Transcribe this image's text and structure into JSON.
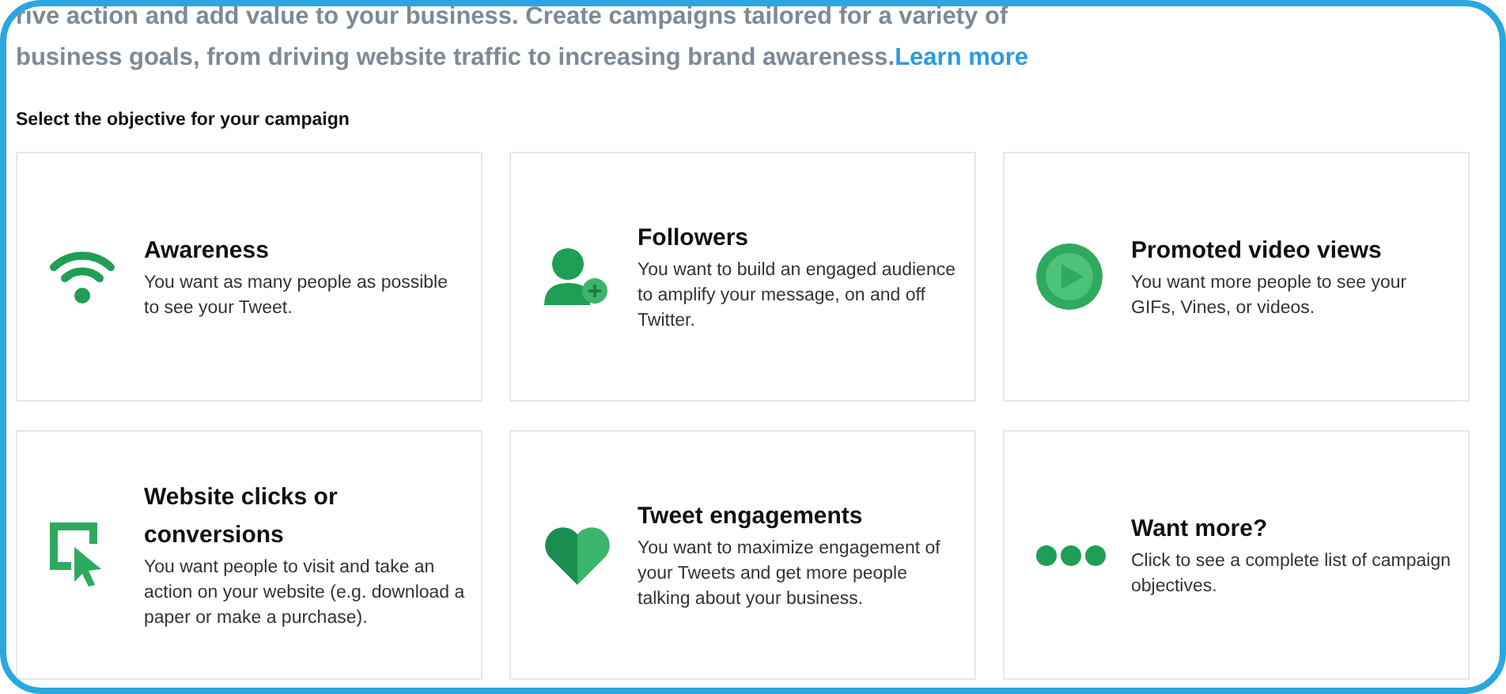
{
  "intro": {
    "lines": [
      "rive action and add value to your business. Create campaigns tailored for a variety of",
      "business goals, from driving website traffic to increasing brand awareness."
    ],
    "link": "Learn more"
  },
  "prompt": "Select the objective for your campaign",
  "objectives": [
    {
      "kind": "wifi",
      "title": "Awareness",
      "description": "You want as many people as possible to see your Tweet."
    },
    {
      "kind": "person-plus",
      "title": "Followers",
      "description": "You want to build an engaged audience to amplify your message, on and off Twitter."
    },
    {
      "kind": "play",
      "title": "Promoted video views",
      "description": "You want more people to see your GIFs, Vines, or videos."
    },
    {
      "kind": "cursor",
      "title": "Website clicks or conversions",
      "description": "You want people to visit and take an action on your website (e.g. download a paper or make a purchase)."
    },
    {
      "kind": "heart",
      "title": "Tweet engagements",
      "description": "You want to maximize engagement of your Tweets and get more people talking about your business."
    },
    {
      "kind": "dots",
      "title": "Want more?",
      "description": "Click to see a complete list of campaign objectives."
    }
  ]
}
